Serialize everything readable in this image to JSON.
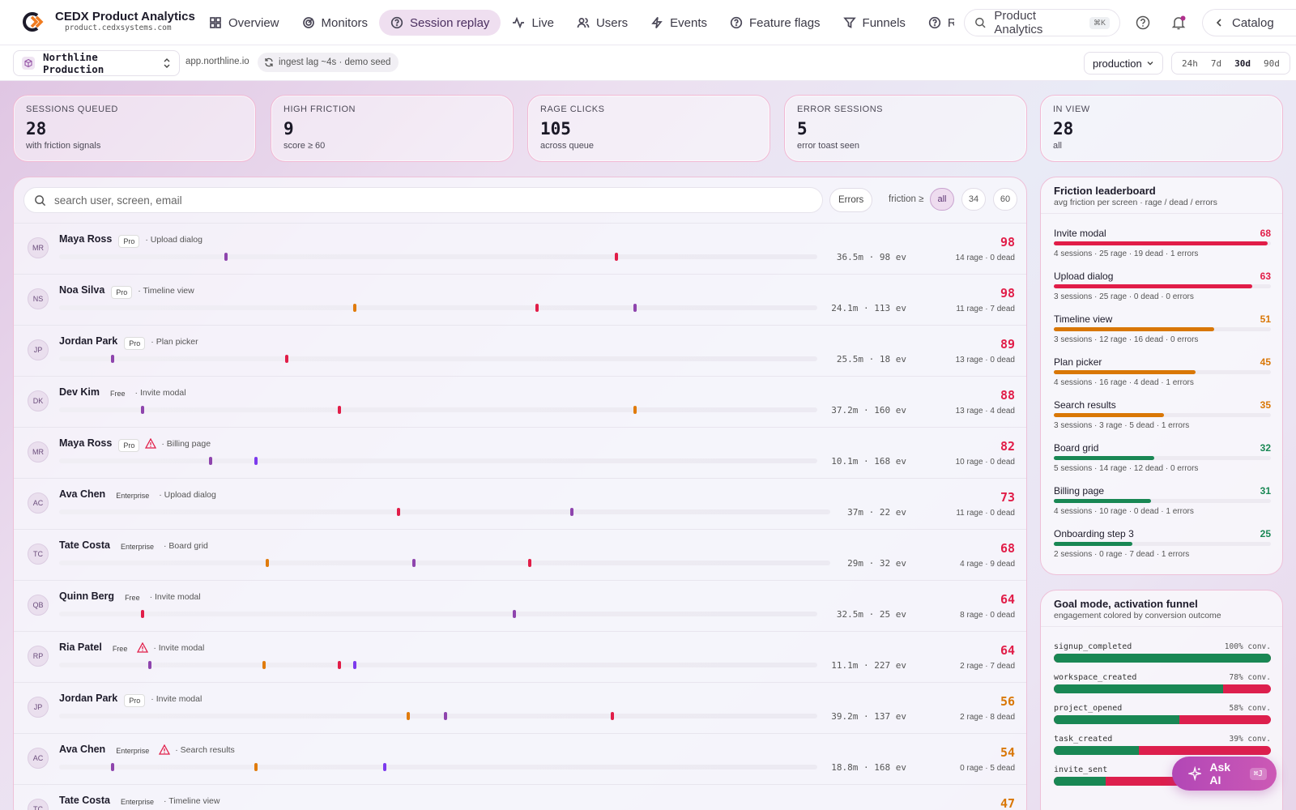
{
  "app": {
    "name": "CEDX Product Analytics",
    "host": "product.cedxsystems.com"
  },
  "nav": [
    {
      "label": "Overview",
      "icon": "grid-icon",
      "active": false
    },
    {
      "label": "Monitors",
      "icon": "radar-icon",
      "active": false
    },
    {
      "label": "Session replay",
      "icon": "replay-icon",
      "active": true
    },
    {
      "label": "Live",
      "icon": "pulse-icon",
      "active": false
    },
    {
      "label": "Users",
      "icon": "users-icon",
      "active": false
    },
    {
      "label": "Events",
      "icon": "bolt-icon",
      "active": false
    },
    {
      "label": "Feature flags",
      "icon": "flag-icon",
      "active": false
    },
    {
      "label": "Funnels",
      "icon": "funnel-icon",
      "active": false
    },
    {
      "label": "Retention",
      "icon": "retention-icon",
      "active": false
    }
  ],
  "global_search": {
    "label": "Product Analytics",
    "shortcut": "⌘K"
  },
  "catalog_label": "Catalog",
  "project": {
    "name": "Northline Production",
    "domain": "app.northline.io",
    "status": "ingest lag ~4s · demo seed"
  },
  "environment": "production",
  "ranges": [
    {
      "label": "24h",
      "active": false
    },
    {
      "label": "7d",
      "active": false
    },
    {
      "label": "30d",
      "active": true
    },
    {
      "label": "90d",
      "active": false
    }
  ],
  "kpis": [
    {
      "label": "Sessions queued",
      "value": "28",
      "sub": "with friction signals"
    },
    {
      "label": "High friction",
      "value": "9",
      "sub": "score ≥ 60"
    },
    {
      "label": "Rage clicks",
      "value": "105",
      "sub": "across queue"
    },
    {
      "label": "Error sessions",
      "value": "5",
      "sub": "error toast seen"
    },
    {
      "label": "In view",
      "value": "28",
      "sub": "all"
    }
  ],
  "search": {
    "placeholder": "search user, screen, email"
  },
  "filters": {
    "errors_label": "Errors",
    "friction_label": "friction ≥",
    "options": [
      {
        "label": "all",
        "active": true
      },
      {
        "label": "34",
        "active": false
      },
      {
        "label": "60",
        "active": false
      }
    ]
  },
  "colors": {
    "rage": "#e11d48",
    "dead": "#8e44ad",
    "error": "#e07b0c",
    "nav": "#7c3aed",
    "score_high": "#e11d48",
    "score_mid": "#d97706",
    "good": "#198754"
  },
  "sessions": [
    {
      "initials": "MR",
      "name": "Maya Ross",
      "plan": "Pro",
      "warn": false,
      "screen": "· Upload dialog",
      "meta": "36.5m · 98 ev",
      "score": "98",
      "counts": "14 rage · 0 dead",
      "markers": [
        {
          "t": 0.22,
          "kind": "dead"
        },
        {
          "t": 0.735,
          "kind": "rage"
        }
      ]
    },
    {
      "initials": "NS",
      "name": "Noa Silva",
      "plan": "Pro",
      "warn": false,
      "screen": "· Timeline view",
      "meta": "24.1m · 113 ev",
      "score": "98",
      "counts": "11 rage · 7 dead",
      "markers": [
        {
          "t": 0.39,
          "kind": "error"
        },
        {
          "t": 0.63,
          "kind": "rage"
        },
        {
          "t": 0.76,
          "kind": "dead"
        }
      ]
    },
    {
      "initials": "JP",
      "name": "Jordan Park",
      "plan": "Pro",
      "warn": false,
      "screen": "· Plan picker",
      "meta": "25.5m · 18 ev",
      "score": "89",
      "counts": "13 rage · 0 dead",
      "markers": [
        {
          "t": 0.07,
          "kind": "dead"
        },
        {
          "t": 0.3,
          "kind": "rage"
        }
      ]
    },
    {
      "initials": "DK",
      "name": "Dev Kim",
      "plan": "Free",
      "warn": false,
      "screen": "· Invite modal",
      "meta": "37.2m · 160 ev",
      "score": "88",
      "counts": "13 rage · 4 dead",
      "markers": [
        {
          "t": 0.11,
          "kind": "dead"
        },
        {
          "t": 0.37,
          "kind": "rage"
        },
        {
          "t": 0.76,
          "kind": "error"
        }
      ]
    },
    {
      "initials": "MR",
      "name": "Maya Ross",
      "plan": "Pro",
      "warn": true,
      "screen": "· Billing page",
      "meta": "10.1m · 168 ev",
      "score": "82",
      "counts": "10 rage · 0 dead",
      "markers": [
        {
          "t": 0.2,
          "kind": "dead"
        },
        {
          "t": 0.26,
          "kind": "nav"
        }
      ]
    },
    {
      "initials": "AC",
      "name": "Ava Chen",
      "plan": "Enterprise",
      "warn": false,
      "screen": "· Upload dialog",
      "meta": "37m · 22 ev",
      "score": "73",
      "counts": "11 rage · 0 dead",
      "markers": [
        {
          "t": 0.44,
          "kind": "rage"
        },
        {
          "t": 0.665,
          "kind": "dead"
        }
      ]
    },
    {
      "initials": "TC",
      "name": "Tate Costa",
      "plan": "Enterprise",
      "warn": false,
      "screen": "· Board grid",
      "meta": "29m · 32 ev",
      "score": "68",
      "counts": "4 rage · 9 dead",
      "markers": [
        {
          "t": 0.27,
          "kind": "error"
        },
        {
          "t": 0.46,
          "kind": "dead"
        },
        {
          "t": 0.61,
          "kind": "rage"
        }
      ]
    },
    {
      "initials": "QB",
      "name": "Quinn Berg",
      "plan": "Free",
      "warn": false,
      "screen": "· Invite modal",
      "meta": "32.5m · 25 ev",
      "score": "64",
      "counts": "8 rage · 0 dead",
      "markers": [
        {
          "t": 0.11,
          "kind": "rage"
        },
        {
          "t": 0.6,
          "kind": "dead"
        }
      ]
    },
    {
      "initials": "RP",
      "name": "Ria Patel",
      "plan": "Free",
      "warn": true,
      "screen": "· Invite modal",
      "meta": "11.1m · 227 ev",
      "score": "64",
      "counts": "2 rage · 7 dead",
      "markers": [
        {
          "t": 0.12,
          "kind": "dead"
        },
        {
          "t": 0.27,
          "kind": "error"
        },
        {
          "t": 0.37,
          "kind": "rage"
        },
        {
          "t": 0.39,
          "kind": "nav"
        }
      ]
    },
    {
      "initials": "JP",
      "name": "Jordan Park",
      "plan": "Pro",
      "warn": false,
      "screen": "· Invite modal",
      "meta": "39.2m · 137 ev",
      "score": "56",
      "counts": "2 rage · 8 dead",
      "markers": [
        {
          "t": 0.46,
          "kind": "error"
        },
        {
          "t": 0.51,
          "kind": "dead"
        },
        {
          "t": 0.73,
          "kind": "rage"
        }
      ]
    },
    {
      "initials": "AC",
      "name": "Ava Chen",
      "plan": "Enterprise",
      "warn": true,
      "screen": "· Search results",
      "meta": "18.8m · 168 ev",
      "score": "54",
      "counts": "0 rage · 5 dead",
      "markers": [
        {
          "t": 0.07,
          "kind": "dead"
        },
        {
          "t": 0.26,
          "kind": "error"
        },
        {
          "t": 0.43,
          "kind": "nav"
        }
      ]
    },
    {
      "initials": "TC",
      "name": "Tate Costa",
      "plan": "Enterprise",
      "warn": false,
      "screen": "· Timeline view",
      "meta": "",
      "score": "47",
      "counts": "",
      "markers": []
    }
  ],
  "leaderboard": {
    "title": "Friction leaderboard",
    "subtitle": "avg friction per screen · rage / dead / errors",
    "items": [
      {
        "name": "Invite modal",
        "score": 68,
        "stats": "4 sessions · 25 rage · 19 dead · 1 errors",
        "color": "#e11d48"
      },
      {
        "name": "Upload dialog",
        "score": 63,
        "stats": "3 sessions · 25 rage · 0 dead · 0 errors",
        "color": "#e11d48"
      },
      {
        "name": "Timeline view",
        "score": 51,
        "stats": "3 sessions · 12 rage · 16 dead · 0 errors",
        "color": "#d97706"
      },
      {
        "name": "Plan picker",
        "score": 45,
        "stats": "4 sessions · 16 rage · 4 dead · 1 errors",
        "color": "#d97706"
      },
      {
        "name": "Search results",
        "score": 35,
        "stats": "3 sessions · 3 rage · 5 dead · 1 errors",
        "color": "#d97706"
      },
      {
        "name": "Board grid",
        "score": 32,
        "stats": "5 sessions · 14 rage · 12 dead · 0 errors",
        "color": "#198754"
      },
      {
        "name": "Billing page",
        "score": 31,
        "stats": "4 sessions · 10 rage · 0 dead · 1 errors",
        "color": "#198754"
      },
      {
        "name": "Onboarding step 3",
        "score": 25,
        "stats": "2 sessions · 0 rage · 7 dead · 1 errors",
        "color": "#198754"
      }
    ]
  },
  "goal_mode": {
    "title": "Goal mode, activation funnel",
    "subtitle": "engagement colored by conversion outcome",
    "steps": [
      {
        "name": "signup_completed",
        "conv": "100% conv.",
        "value": 1.0
      },
      {
        "name": "workspace_created",
        "conv": "78% conv.",
        "value": 0.78
      },
      {
        "name": "project_opened",
        "conv": "58% conv.",
        "value": 0.58
      },
      {
        "name": "task_created",
        "conv": "39% conv.",
        "value": 0.39
      },
      {
        "name": "invite_sent",
        "conv": "",
        "value": 0.24
      }
    ]
  },
  "ask_ai": {
    "label": "Ask AI",
    "shortcut": "⌘J"
  }
}
